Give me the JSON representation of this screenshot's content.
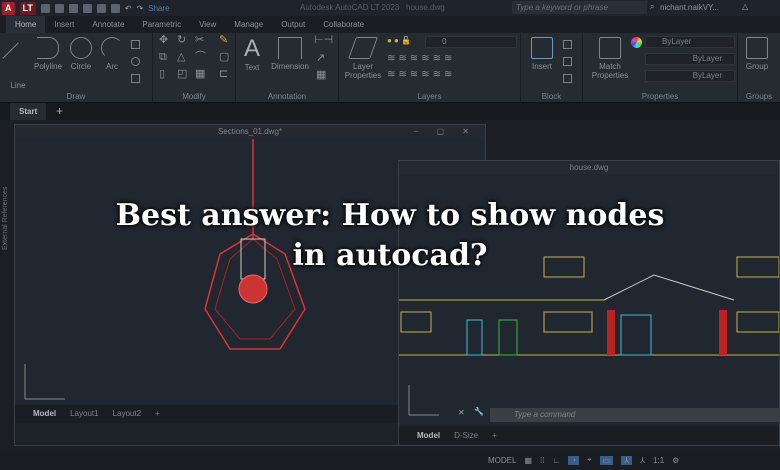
{
  "titlebar": {
    "logo": "A",
    "badge": "LT",
    "share": "Share",
    "app_title": "Autodesk AutoCAD LT 2023",
    "file": "house.dwg",
    "search_placeholder": "Type a keyword or phrase",
    "user": "nichant.naikVY..."
  },
  "tabs": [
    "Home",
    "Insert",
    "Annotate",
    "Parametric",
    "View",
    "Manage",
    "Output",
    "Collaborate"
  ],
  "ribbon": {
    "draw": {
      "title": "Draw",
      "tools": [
        "Line",
        "Polyline",
        "Circle",
        "Arc"
      ]
    },
    "modify": {
      "title": "Modify"
    },
    "annotation": {
      "title": "Annotation",
      "tools": [
        "Text",
        "Dimension"
      ]
    },
    "layers": {
      "title": "Layers",
      "tool": "Layer Properties",
      "current_layer": "0"
    },
    "block": {
      "title": "Block",
      "tool": "Insert"
    },
    "properties": {
      "title": "Properties",
      "tool": "Match Properties",
      "color": "ByLayer",
      "linetype": "ByLayer",
      "lineweight": "ByLayer"
    },
    "groups": {
      "title": "Groups",
      "tool": "Group"
    }
  },
  "file_tabs": {
    "start": "Start",
    "add": "+"
  },
  "windows": {
    "left": {
      "title": "Sections_01.dwg*",
      "side_label": "External References",
      "layouts": [
        "Model",
        "Layout1",
        "Layout2",
        "+"
      ]
    },
    "right": {
      "title": "house.dwg",
      "layouts": [
        "Model",
        "D-Size",
        "+"
      ],
      "command_placeholder": "Type a command"
    }
  },
  "statusbar": {
    "model": "MODEL",
    "scale": "1:1"
  },
  "overlay": {
    "line1": "Best answer: How to show nodes",
    "line2": "in autocad?"
  }
}
